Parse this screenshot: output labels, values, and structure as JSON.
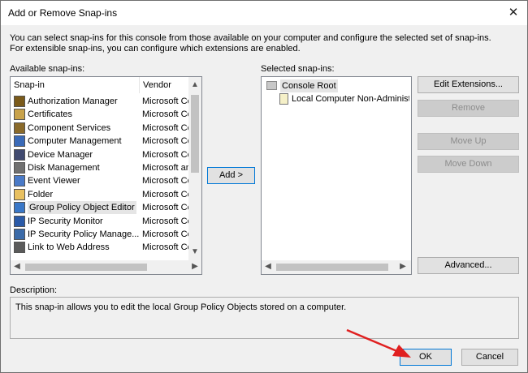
{
  "window": {
    "title": "Add or Remove Snap-ins"
  },
  "intro_text": "You can select snap-ins for this console from those available on your computer and configure the selected set of snap-ins. For extensible snap-ins, you can configure which extensions are enabled.",
  "available": {
    "label": "Available snap-ins:",
    "columns": [
      "Snap-in",
      "Vendor"
    ],
    "items": [
      {
        "name": "Authorization Manager",
        "vendor": "Microsoft Co",
        "icon": "authorization-manager-icon"
      },
      {
        "name": "Certificates",
        "vendor": "Microsoft Co",
        "icon": "certificates-icon"
      },
      {
        "name": "Component Services",
        "vendor": "Microsoft Co",
        "icon": "component-services-icon"
      },
      {
        "name": "Computer Management",
        "vendor": "Microsoft Co",
        "icon": "computer-management-icon"
      },
      {
        "name": "Device Manager",
        "vendor": "Microsoft Co",
        "icon": "device-manager-icon"
      },
      {
        "name": "Disk Management",
        "vendor": "Microsoft an",
        "icon": "disk-management-icon"
      },
      {
        "name": "Event Viewer",
        "vendor": "Microsoft Co",
        "icon": "event-viewer-icon"
      },
      {
        "name": "Folder",
        "vendor": "Microsoft Co",
        "icon": "folder-icon"
      },
      {
        "name": "Group Policy Object Editor",
        "vendor": "Microsoft Co",
        "icon": "group-policy-icon",
        "selected": true
      },
      {
        "name": "IP Security Monitor",
        "vendor": "Microsoft Co",
        "icon": "ip-security-monitor-icon"
      },
      {
        "name": "IP Security Policy Manage...",
        "vendor": "Microsoft Co",
        "icon": "ip-security-policy-icon"
      },
      {
        "name": "Link to Web Address",
        "vendor": "Microsoft Co",
        "icon": "link-icon"
      }
    ]
  },
  "add_button": "Add >",
  "selected": {
    "label": "Selected snap-ins:",
    "tree": [
      {
        "name": "Console Root",
        "icon": "folder-icon",
        "level": 0
      },
      {
        "name": "Local Computer Non-Administra",
        "icon": "policy-document-icon",
        "level": 1
      }
    ]
  },
  "buttons": {
    "edit_extensions": "Edit Extensions...",
    "remove": "Remove",
    "move_up": "Move Up",
    "move_down": "Move Down",
    "advanced": "Advanced...",
    "ok": "OK",
    "cancel": "Cancel"
  },
  "description": {
    "label": "Description:",
    "text": "This snap-in allows you to edit the local Group Policy Objects stored on a computer."
  },
  "colors": {
    "selection": "#e5e5e5",
    "accent": "#0078d7",
    "annotation_arrow": "#e02020"
  }
}
